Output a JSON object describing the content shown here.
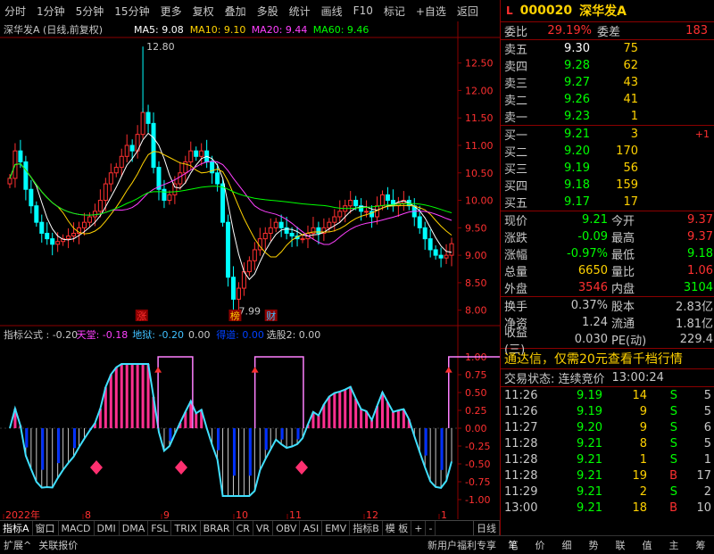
{
  "toolbar": {
    "items": [
      "分时",
      "1分钟",
      "5分钟",
      "15分钟",
      "更多",
      "复权",
      "叠加",
      "多股",
      "统计",
      "画线",
      "F10",
      "标记",
      "+自选",
      "返回"
    ]
  },
  "header": {
    "title": "深华发A (日线,前复权)",
    "ma": [
      {
        "label": "MA5: 9.08",
        "color": "#ffffff"
      },
      {
        "label": "MA10: 9.10",
        "color": "#ffd200"
      },
      {
        "label": "MA20: 9.44",
        "color": "#ff40ff"
      },
      {
        "label": "MA60: 9.46",
        "color": "#00ff00"
      }
    ]
  },
  "chart_data": [
    {
      "type": "candlestick",
      "title": "深华发A (日线,前复权)",
      "ylim": [
        7.8,
        12.9
      ],
      "yticks": [
        "12.50",
        "12.00",
        "11.50",
        "11.00",
        "10.50",
        "10.00",
        "9.50",
        "9.00",
        "8.50",
        "8.00"
      ],
      "annotations": [
        {
          "text": "12.80",
          "note": "high"
        },
        {
          "text": "7.99",
          "note": "low"
        },
        {
          "text": "涨"
        },
        {
          "text": "榜"
        },
        {
          "text": "财"
        }
      ],
      "x_months": [
        "2022年",
        "8",
        "9",
        "10",
        "11",
        "12",
        "1"
      ],
      "close": [
        10.4,
        10.9,
        10.7,
        10.2,
        9.9,
        9.6,
        9.4,
        9.3,
        9.2,
        9.25,
        9.3,
        9.35,
        9.4,
        9.5,
        9.6,
        9.7,
        9.8,
        10.0,
        10.3,
        10.5,
        10.6,
        10.8,
        11.0,
        10.9,
        11.2,
        11.6,
        11.4,
        10.6,
        10.2,
        10.0,
        10.1,
        10.3,
        10.5,
        10.7,
        10.9,
        10.8,
        10.9,
        10.7,
        10.5,
        10.3,
        9.6,
        8.6,
        8.2,
        8.4,
        8.7,
        8.9,
        9.1,
        9.3,
        9.4,
        9.5,
        9.6,
        9.5,
        9.4,
        9.35,
        9.3,
        9.3,
        9.4,
        9.5,
        9.4,
        9.5,
        9.6,
        9.7,
        9.8,
        9.9,
        10.0,
        9.9,
        9.8,
        9.8,
        9.7,
        9.9,
        10.1,
        10.0,
        9.9,
        9.95,
        10.0,
        9.9,
        9.7,
        9.5,
        9.3,
        9.1,
        9.0,
        8.95,
        9.0,
        9.21
      ],
      "ma_series": [
        {
          "name": "MA5",
          "color": "#ffffff"
        },
        {
          "name": "MA10",
          "color": "#ffd200"
        },
        {
          "name": "MA20",
          "color": "#ff40ff"
        },
        {
          "name": "MA60",
          "color": "#00ff00"
        }
      ]
    },
    {
      "type": "bar",
      "title": "指标公式",
      "header_values": [
        {
          "label": "指标公式 : -0.20",
          "color": "#c8c8c8"
        },
        {
          "label": "天堂: -0.18",
          "color": "#ff40ff"
        },
        {
          "label": "地狱: -0.20",
          "color": "#40c0ff"
        },
        {
          "label": "0.00",
          "color": "#c8c8c8"
        },
        {
          "label": "得道: 0.00",
          "color": "#0040ff"
        },
        {
          "label": "选股2: 0.00",
          "color": "#c8c8c8"
        }
      ],
      "ylim": [
        -1.2,
        1.2
      ],
      "yticks": [
        "1.00",
        "0.75",
        "0.50",
        "0.25",
        "0.00",
        "-0.25",
        "-0.50",
        "-0.75",
        "-1.00"
      ]
    }
  ],
  "bottom_tabs": [
    "指标A",
    "窗口",
    "MACD",
    "DMI",
    "DMA",
    "FSL",
    "TRIX",
    "BRAR",
    "CR",
    "VR",
    "OBV",
    "ASI",
    "EMV",
    "指标B",
    "模 板",
    "+",
    "-"
  ],
  "day_label": "日线",
  "status_left": [
    "扩展^",
    "关联报价"
  ],
  "status_right": "新用户福利专享",
  "right_tabs": [
    "笔",
    "价",
    "细",
    "势",
    "联",
    "值",
    "主",
    "筹"
  ],
  "quote": {
    "marker": "L",
    "code": "000020",
    "name": "深华发A",
    "weibi_label": "委比",
    "weibi": "29.19%",
    "weicha_label": "委差",
    "weicha": "183",
    "asks": [
      {
        "label": "卖五",
        "price": "9.30",
        "vol": "75",
        "price_color": "#ffffff"
      },
      {
        "label": "卖四",
        "price": "9.28",
        "vol": "62",
        "price_color": "#00ff00"
      },
      {
        "label": "卖三",
        "price": "9.27",
        "vol": "43",
        "price_color": "#00ff00"
      },
      {
        "label": "卖二",
        "price": "9.26",
        "vol": "41",
        "price_color": "#00ff00"
      },
      {
        "label": "卖一",
        "price": "9.23",
        "vol": "1",
        "price_color": "#00ff00"
      }
    ],
    "bids": [
      {
        "label": "买一",
        "price": "9.21",
        "vol": "3",
        "chg": "+1"
      },
      {
        "label": "买二",
        "price": "9.20",
        "vol": "170",
        "chg": ""
      },
      {
        "label": "买三",
        "price": "9.19",
        "vol": "56",
        "chg": ""
      },
      {
        "label": "买四",
        "price": "9.18",
        "vol": "159",
        "chg": ""
      },
      {
        "label": "买五",
        "price": "9.17",
        "vol": "17",
        "chg": ""
      }
    ],
    "stats": [
      {
        "l1": "现价",
        "v1": "9.21",
        "c1": "#00ff00",
        "l2": "今开",
        "v2": "9.37",
        "c2": "#ff3030"
      },
      {
        "l1": "涨跌",
        "v1": "-0.09",
        "c1": "#00ff00",
        "l2": "最高",
        "v2": "9.37",
        "c2": "#ff3030"
      },
      {
        "l1": "涨幅",
        "v1": "-0.97%",
        "c1": "#00ff00",
        "l2": "最低",
        "v2": "9.18",
        "c2": "#00ff00"
      },
      {
        "l1": "总量",
        "v1": "6650",
        "c1": "#ffd200",
        "l2": "量比",
        "v2": "1.06",
        "c2": "#ff3030"
      },
      {
        "l1": "外盘",
        "v1": "3546",
        "c1": "#ff3030",
        "l2": "内盘",
        "v2": "3104",
        "c2": "#00ff00"
      }
    ],
    "stats2": [
      {
        "l1": "换手",
        "v1": "0.37%",
        "l2": "股本",
        "v2": "2.83亿"
      },
      {
        "l1": "净资",
        "v1": "1.24",
        "l2": "流通",
        "v2": "1.81亿"
      },
      {
        "l1": "收益(三)",
        "v1": "0.030",
        "l2": "PE(动)",
        "v2": "229.4"
      }
    ],
    "promo": "通达信，仅需20元查看千档行情",
    "trade_status_label": "交易状态: 连续竞价",
    "trade_time": "13:00:24",
    "ticks": [
      {
        "time": "11:26",
        "price": "9.19",
        "vol": "14",
        "side": "S",
        "num": "5"
      },
      {
        "time": "11:26",
        "price": "9.19",
        "vol": "9",
        "side": "S",
        "num": "5"
      },
      {
        "time": "11:27",
        "price": "9.20",
        "vol": "9",
        "side": "S",
        "num": "6"
      },
      {
        "time": "11:28",
        "price": "9.21",
        "vol": "8",
        "side": "S",
        "num": "5"
      },
      {
        "time": "11:28",
        "price": "9.21",
        "vol": "1",
        "side": "S",
        "num": "1"
      },
      {
        "time": "11:28",
        "price": "9.21",
        "vol": "19",
        "side": "B",
        "num": "17"
      },
      {
        "time": "11:29",
        "price": "9.21",
        "vol": "2",
        "side": "S",
        "num": "2"
      },
      {
        "time": "13:00",
        "price": "9.21",
        "vol": "18",
        "side": "B",
        "num": "10"
      }
    ]
  }
}
